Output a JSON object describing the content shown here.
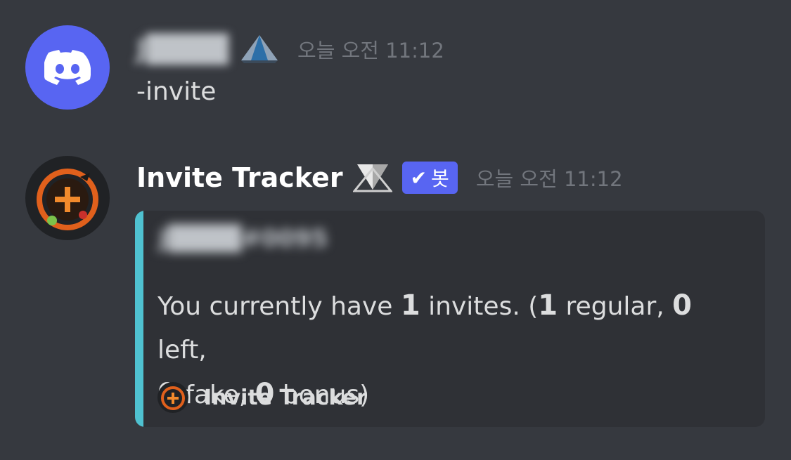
{
  "messages": [
    {
      "username": "J████",
      "timestamp": "오늘 오전 11:12",
      "content": "-invite",
      "avatar_icon": "discord-logo-icon",
      "badge_icon": "prism-badge-icon"
    },
    {
      "username": "Invite Tracker",
      "timestamp": "오늘 오전 11:12",
      "bot_tag": {
        "check": "✔",
        "label": "봇"
      },
      "avatar_icon": "invite-tracker-logo-icon",
      "badge_icon": "prism-badge-icon",
      "embed": {
        "author": "J████#0095",
        "desc": {
          "p1": "You currently have ",
          "total": "1",
          "p2": " invites. (",
          "regular": "1",
          "p3": " regular, ",
          "left": "0",
          "p4": " left,",
          "fake": "0",
          "p5": " fake, ",
          "bonus": "0",
          "p6": " bonus)"
        },
        "footer": "Invite Tracker",
        "accent_color": "#4fc1d0"
      }
    }
  ],
  "colors": {
    "background": "#36393f",
    "embed_bg": "#2f3136",
    "blurple": "#5865f2",
    "timestamp": "#72767d"
  }
}
